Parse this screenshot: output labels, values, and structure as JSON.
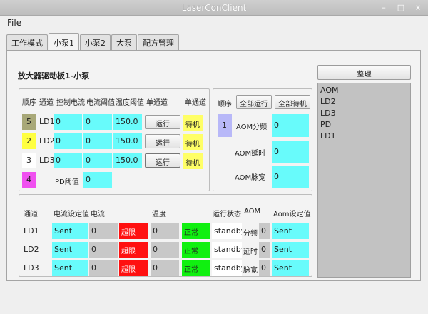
{
  "window": {
    "title": "LaserConClient",
    "min": "–",
    "max": "□",
    "close": "×"
  },
  "menu": {
    "file": "File"
  },
  "tabs": [
    "工作模式",
    "小泵1",
    "小泵2",
    "大泵",
    "配方管理"
  ],
  "board_title": "放大器驱动板1-小泵",
  "tidy_button": "整理",
  "list_items": [
    "AOM",
    "LD2",
    "LD3",
    "PD",
    "LD1"
  ],
  "g1": {
    "headers": [
      "顺序",
      "通道",
      "控制电流",
      "电流阈值",
      "温度阈值",
      "单通道",
      "单通道"
    ],
    "rows": [
      {
        "order": "5",
        "order_color": "#a8a878",
        "channel": "LD1",
        "ctrl": "0",
        "limit": "0",
        "temp": "150.0",
        "btn": "运行",
        "status": "待机"
      },
      {
        "order": "2",
        "order_color": "#ffff40",
        "channel": "LD2",
        "ctrl": "0",
        "limit": "0",
        "temp": "150.0",
        "btn": "运行",
        "status": "待机"
      },
      {
        "order": "3",
        "order_color": "#ffffff",
        "channel": "LD3",
        "ctrl": "0",
        "limit": "0",
        "temp": "150.0",
        "btn": "运行",
        "status": "待机"
      }
    ],
    "pd": {
      "order": "4",
      "order_color": "#f050f0",
      "label": "PD阈值",
      "value": "0"
    }
  },
  "g2": {
    "order_label": "顺序",
    "run_all": "全部运行",
    "standby_all": "全部待机",
    "order": "1",
    "order_color": "#b8b8f8",
    "rows": [
      {
        "label": "AOM分频",
        "value": "0"
      },
      {
        "label": "AOM延时",
        "value": "0"
      },
      {
        "label": "AOM脉宽",
        "value": "0"
      }
    ]
  },
  "g3": {
    "headers": [
      "通道",
      "电流设定值",
      "电流",
      "温度",
      "运行状态",
      "AOM",
      "Aom设定值"
    ],
    "rows": [
      {
        "channel": "LD1",
        "set": "Sent",
        "current": "0",
        "over": "超限",
        "temp": "0",
        "ok": "正常",
        "state": "standby",
        "aom": "分频",
        "aom_val": "0",
        "aom_set": "Sent"
      },
      {
        "channel": "LD2",
        "set": "Sent",
        "current": "0",
        "over": "超限",
        "temp": "0",
        "ok": "正常",
        "state": "standby",
        "aom": "延时",
        "aom_val": "0",
        "aom_set": "Sent"
      },
      {
        "channel": "LD3",
        "set": "Sent",
        "current": "0",
        "over": "超限",
        "temp": "0",
        "ok": "正常",
        "state": "standby",
        "aom": "脉宽",
        "aom_val": "0",
        "aom_set": "Sent"
      }
    ]
  }
}
